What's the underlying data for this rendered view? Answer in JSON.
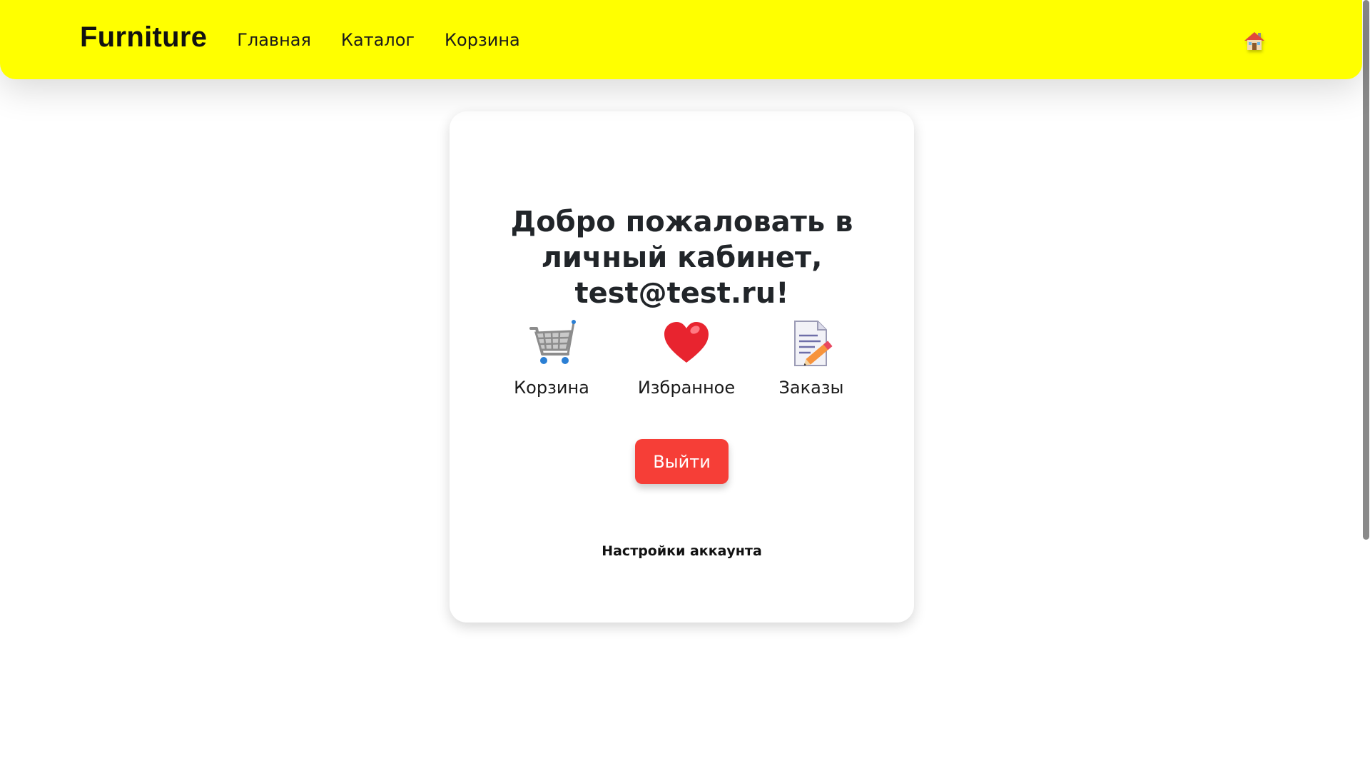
{
  "navbar": {
    "brand": "Furniture",
    "links": [
      "Главная",
      "Каталог",
      "Корзина"
    ],
    "home_icon": "house-icon"
  },
  "account": {
    "welcome": "Добро пожаловать в личный кабинет, test@test.ru!",
    "features": [
      {
        "label": "Корзина",
        "icon": "shopping-cart-icon"
      },
      {
        "label": "Избранное",
        "icon": "heart-icon"
      },
      {
        "label": "Заказы",
        "icon": "memo-icon"
      }
    ],
    "logout_label": "Выйти",
    "settings_label": "Настройки аккаунта"
  },
  "colors": {
    "navbar_bg": "#ffff00",
    "logout_bg": "#f63e37",
    "heart": "#e8242f"
  }
}
